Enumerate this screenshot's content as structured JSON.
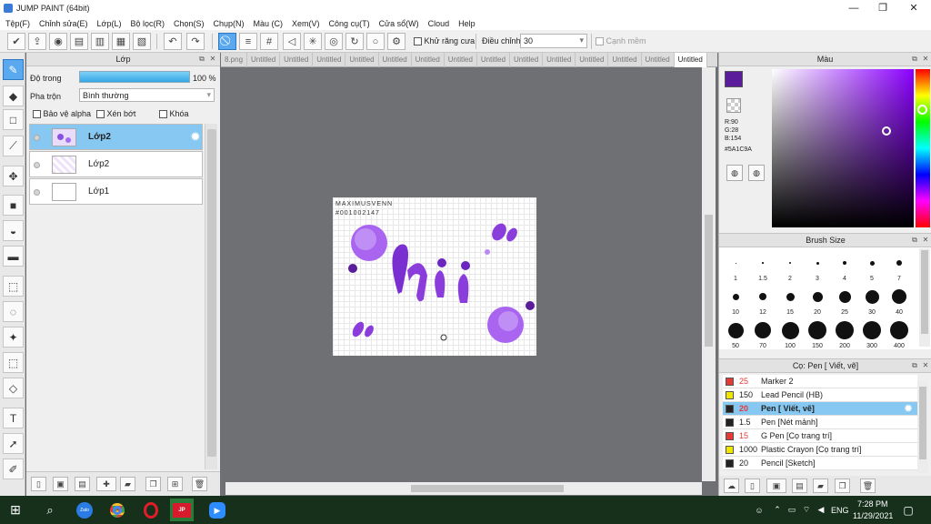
{
  "window": {
    "title": "JUMP PAINT (64bit)",
    "minimize": "—",
    "maximize": "❐",
    "close": "✕"
  },
  "menu": [
    "Tệp(F)",
    "Chỉnh sửa(E)",
    "Lớp(L)",
    "Bộ lọc(R)",
    "Chọn(S)",
    "Chụp(N)",
    "Màu (C)",
    "Xem(V)",
    "Công cụ(T)",
    "Cửa sổ(W)",
    "Cloud",
    "Help"
  ],
  "toolbar": {
    "antialias_label": "Khử răng cưa",
    "adjust_label": "Điều chỉnh",
    "adjust_value": "30",
    "sharpen_label": "Cạnh mềm"
  },
  "layers": {
    "title": "Lớp",
    "opacity_label": "Độ trong",
    "opacity_value": "100 %",
    "blend_label": "Pha trộn",
    "blend_value": "Bình thường",
    "protect_alpha": "Bảo vệ alpha",
    "clip": "Xén bớt",
    "lock": "Khóa",
    "items": [
      {
        "name": "Lớp2",
        "selected": true
      },
      {
        "name": "Lớp2",
        "selected": false
      },
      {
        "name": "Lớp1",
        "selected": false
      }
    ]
  },
  "canvas": {
    "tabs": [
      "8.png",
      "Untitled",
      "Untitled",
      "Untitled",
      "Untitled",
      "Untitled",
      "Untitled",
      "Untitled",
      "Untitled",
      "Untitled",
      "Untitled",
      "Untitled",
      "Untitled",
      "Untitled",
      "Untitled"
    ],
    "art_text_top": "MAXIMUSVENN",
    "art_text_sub": "#001002147",
    "art_word": "hii"
  },
  "color": {
    "title": "Màu",
    "r": "R:90",
    "g": "G:28",
    "b": "B:154",
    "hex": "#5A1C9A",
    "main_hex": "#5a1c9a"
  },
  "brush_size": {
    "title": "Brush Size",
    "sizes": [
      "1",
      "1.5",
      "2",
      "3",
      "4",
      "5",
      "7",
      "10",
      "12",
      "15",
      "20",
      "25",
      "30",
      "40",
      "50",
      "70",
      "100",
      "150",
      "200",
      "300",
      "400"
    ]
  },
  "brushes": {
    "title": "Cọ: Pen [ Viết, vẽ]",
    "items": [
      {
        "num": "25",
        "name": "Marker 2",
        "color": "#e53935",
        "sel": false
      },
      {
        "num": "150",
        "name": "Lead Pencil (HB)",
        "color": "#f2e600",
        "sel": false
      },
      {
        "num": "20",
        "name": "Pen [ Viết, vẽ]",
        "color": "#222222",
        "sel": true
      },
      {
        "num": "1.5",
        "name": "Pen [Nét mảnh]",
        "color": "#222222",
        "sel": false
      },
      {
        "num": "15",
        "name": "G Pen [Cọ trang trí]",
        "color": "#e53935",
        "sel": false
      },
      {
        "num": "1000",
        "name": "Plastic Crayon [Cọ trang trí]",
        "color": "#f2e600",
        "sel": false
      },
      {
        "num": "20",
        "name": "Pencil [Sketch]",
        "color": "#222222",
        "sel": false
      }
    ]
  },
  "taskbar": {
    "lang": "ENG",
    "time": "7:28 PM",
    "date": "11/29/2021",
    "zalo": "Zalo"
  }
}
